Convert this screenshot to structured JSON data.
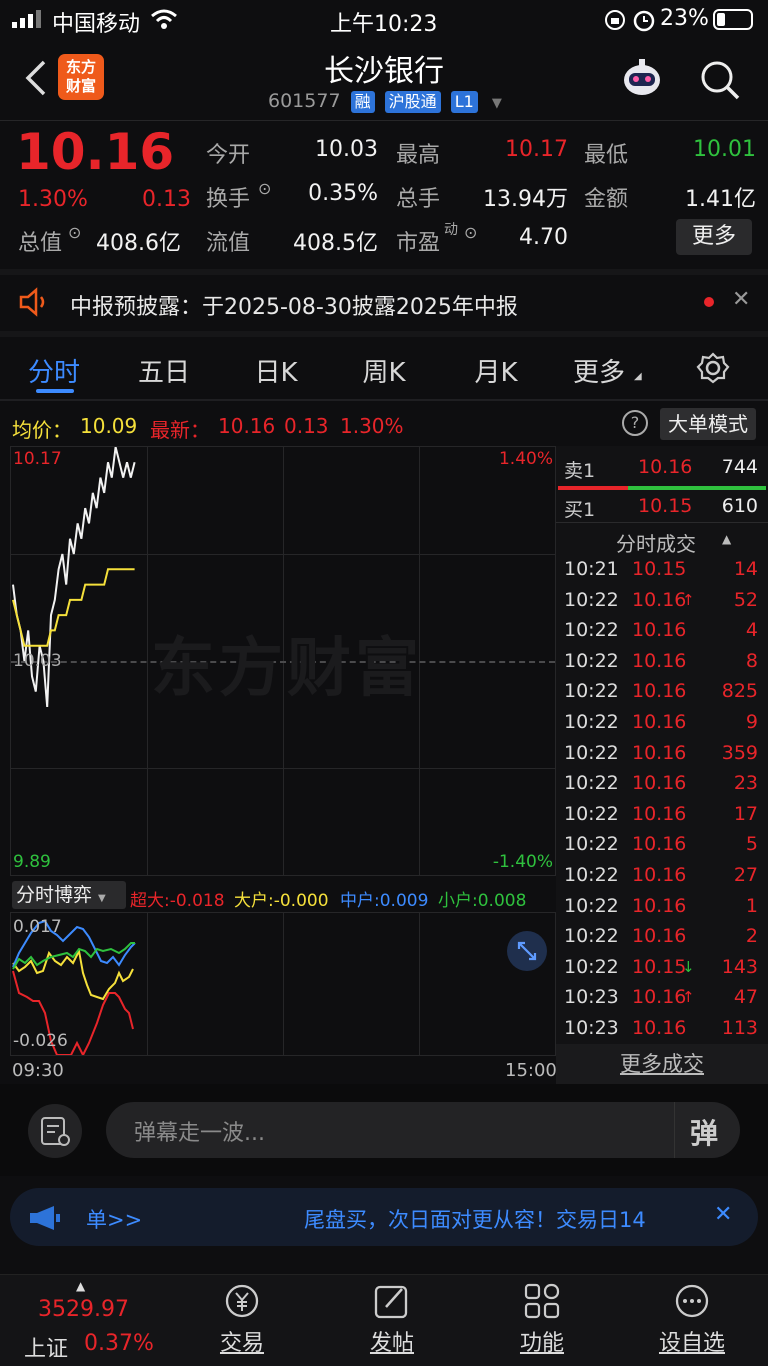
{
  "status_bar": {
    "carrier": "中国移动",
    "time": "上午10:23",
    "battery": "23%"
  },
  "header": {
    "logo_text_line1": "东方",
    "logo_text_line2": "财富",
    "title": "长沙银行",
    "code": "601577",
    "tags": [
      "融",
      "沪股通",
      "L1"
    ]
  },
  "quote": {
    "price": "10.16",
    "change_pct": "1.30%",
    "change_abs": "0.13",
    "total_value_label": "总值",
    "total_value": "408.6亿",
    "labels": {
      "open": "今开",
      "high": "最高",
      "low": "最低",
      "turnover": "换手",
      "volume": "总手",
      "amount": "金额",
      "float_value": "流值",
      "pe": "市盈"
    },
    "open": "10.03",
    "high": "10.17",
    "low": "10.01",
    "turnover": "0.35%",
    "volume": "13.94万",
    "amount": "1.41亿",
    "float_value": "408.5亿",
    "pe_sup": "动",
    "pe": "4.70",
    "more_button": "更多"
  },
  "notice": {
    "text": "中报预披露：于2025-08-30披露2025年中报"
  },
  "tabs": [
    "分时",
    "五日",
    "日K",
    "周K",
    "月K",
    "更多"
  ],
  "chart_header": {
    "avg_label": "均价：",
    "avg_value": "10.09",
    "latest_label": "最新：",
    "latest_price": "10.16",
    "latest_change": "0.13",
    "latest_pct": "1.30%",
    "mode_button": "大单模式"
  },
  "chart_data": {
    "type": "line",
    "y_top": "10.17",
    "y_mid": "10.03",
    "y_bottom": "9.89",
    "pct_top": "1.40%",
    "pct_bottom": "-1.40%",
    "watermark": "东方财富",
    "time_start": "09:30",
    "time_end": "15:00",
    "ylim": [
      9.89,
      10.17
    ],
    "series": [
      {
        "values": [
          10.08,
          10.06,
          10.05,
          10.03,
          10.05,
          10.02,
          10.01,
          10.04,
          10.03,
          10.0,
          10.06,
          10.07,
          10.09,
          10.1,
          10.08,
          10.11,
          10.1,
          10.12,
          10.11,
          10.13,
          10.12,
          10.14,
          10.13,
          10.15,
          10.14,
          10.16,
          10.15,
          10.17,
          10.16,
          10.15,
          10.16,
          10.15,
          10.16
        ]
      },
      {
        "values": [
          10.07,
          10.06,
          10.05,
          10.04,
          10.04,
          10.04,
          10.04,
          10.04,
          10.04,
          10.04,
          10.05,
          10.05,
          10.06,
          10.06,
          10.06,
          10.07,
          10.07,
          10.07,
          10.07,
          10.08,
          10.08,
          10.08,
          10.08,
          10.08,
          10.08,
          10.09,
          10.09,
          10.09,
          10.09,
          10.09,
          10.09,
          10.09,
          10.09
        ]
      }
    ]
  },
  "sub_chart": {
    "selector": "分时博弈",
    "legend": [
      {
        "label": "超大:",
        "value": "-0.018"
      },
      {
        "label": "大户:",
        "value": "-0.000"
      },
      {
        "label": "中户:",
        "value": "0.009"
      },
      {
        "label": "小户:",
        "value": "0.008"
      }
    ],
    "y_top": "0.017",
    "y_bottom": "-0.026"
  },
  "order_book": {
    "sell_label": "卖1",
    "sell_price": "10.16",
    "sell_vol": "744",
    "buy_label": "买1",
    "buy_price": "10.15",
    "buy_vol": "610"
  },
  "trades": {
    "title": "分时成交",
    "rows": [
      {
        "time": "10:21",
        "price": "10.15",
        "vol": "14",
        "arrow": ""
      },
      {
        "time": "10:22",
        "price": "10.16",
        "vol": "52",
        "arrow": "↑"
      },
      {
        "time": "10:22",
        "price": "10.16",
        "vol": "4",
        "arrow": ""
      },
      {
        "time": "10:22",
        "price": "10.16",
        "vol": "8",
        "arrow": ""
      },
      {
        "time": "10:22",
        "price": "10.16",
        "vol": "825",
        "arrow": ""
      },
      {
        "time": "10:22",
        "price": "10.16",
        "vol": "9",
        "arrow": ""
      },
      {
        "time": "10:22",
        "price": "10.16",
        "vol": "359",
        "arrow": ""
      },
      {
        "time": "10:22",
        "price": "10.16",
        "vol": "23",
        "arrow": ""
      },
      {
        "time": "10:22",
        "price": "10.16",
        "vol": "17",
        "arrow": ""
      },
      {
        "time": "10:22",
        "price": "10.16",
        "vol": "5",
        "arrow": ""
      },
      {
        "time": "10:22",
        "price": "10.16",
        "vol": "27",
        "arrow": ""
      },
      {
        "time": "10:22",
        "price": "10.16",
        "vol": "1",
        "arrow": ""
      },
      {
        "time": "10:22",
        "price": "10.16",
        "vol": "2",
        "arrow": ""
      },
      {
        "time": "10:22",
        "price": "10.15",
        "vol": "143",
        "arrow": "↓"
      },
      {
        "time": "10:23",
        "price": "10.16",
        "vol": "47",
        "arrow": "↑"
      },
      {
        "time": "10:23",
        "price": "10.16",
        "vol": "113",
        "arrow": ""
      }
    ],
    "more_link": "更多成交"
  },
  "comment": {
    "placeholder": "弹幕走一波...",
    "danmu_glyph": "弹"
  },
  "marquee": {
    "left_text": "单>>",
    "text": "尾盘买，次日面对更从容！交易日14"
  },
  "bottom_nav": {
    "index_value": "3529.97",
    "index_name": "上证",
    "index_pct": "0.37%",
    "items": [
      "交易",
      "发帖",
      "功能",
      "设自选"
    ]
  }
}
